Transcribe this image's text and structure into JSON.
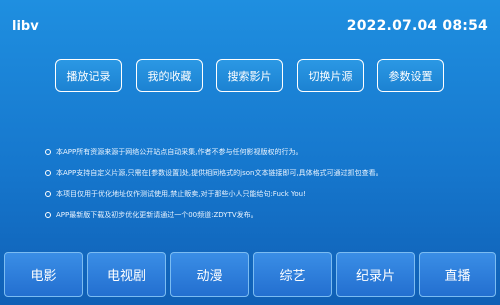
{
  "header": {
    "app_title": "libv",
    "clock": "2022.07.04 08:54"
  },
  "top_menu": [
    {
      "label": "播放记录"
    },
    {
      "label": "我的收藏"
    },
    {
      "label": "搜索影片"
    },
    {
      "label": "切换片源"
    },
    {
      "label": "参数设置"
    }
  ],
  "notices": [
    "本APP所有资源来源于网络公开站点自动采集,作者不参与任何影视版权的行为。",
    "本APP支持自定义片源,只需在[参数设置]处,提供相同格式的json文本链接即可,具体格式可通过抓包查看。",
    "本项目仅用于优化地址仅作测试使用,禁止贩卖,对于那些小人只能给句:Fuck You!",
    "APP最新版下载及初步优化更新请通过一个00频道:ZDYTV发布。"
  ],
  "categories": [
    {
      "label": "电影"
    },
    {
      "label": "电视剧"
    },
    {
      "label": "动漫"
    },
    {
      "label": "综艺"
    },
    {
      "label": "纪录片"
    },
    {
      "label": "直播"
    }
  ]
}
